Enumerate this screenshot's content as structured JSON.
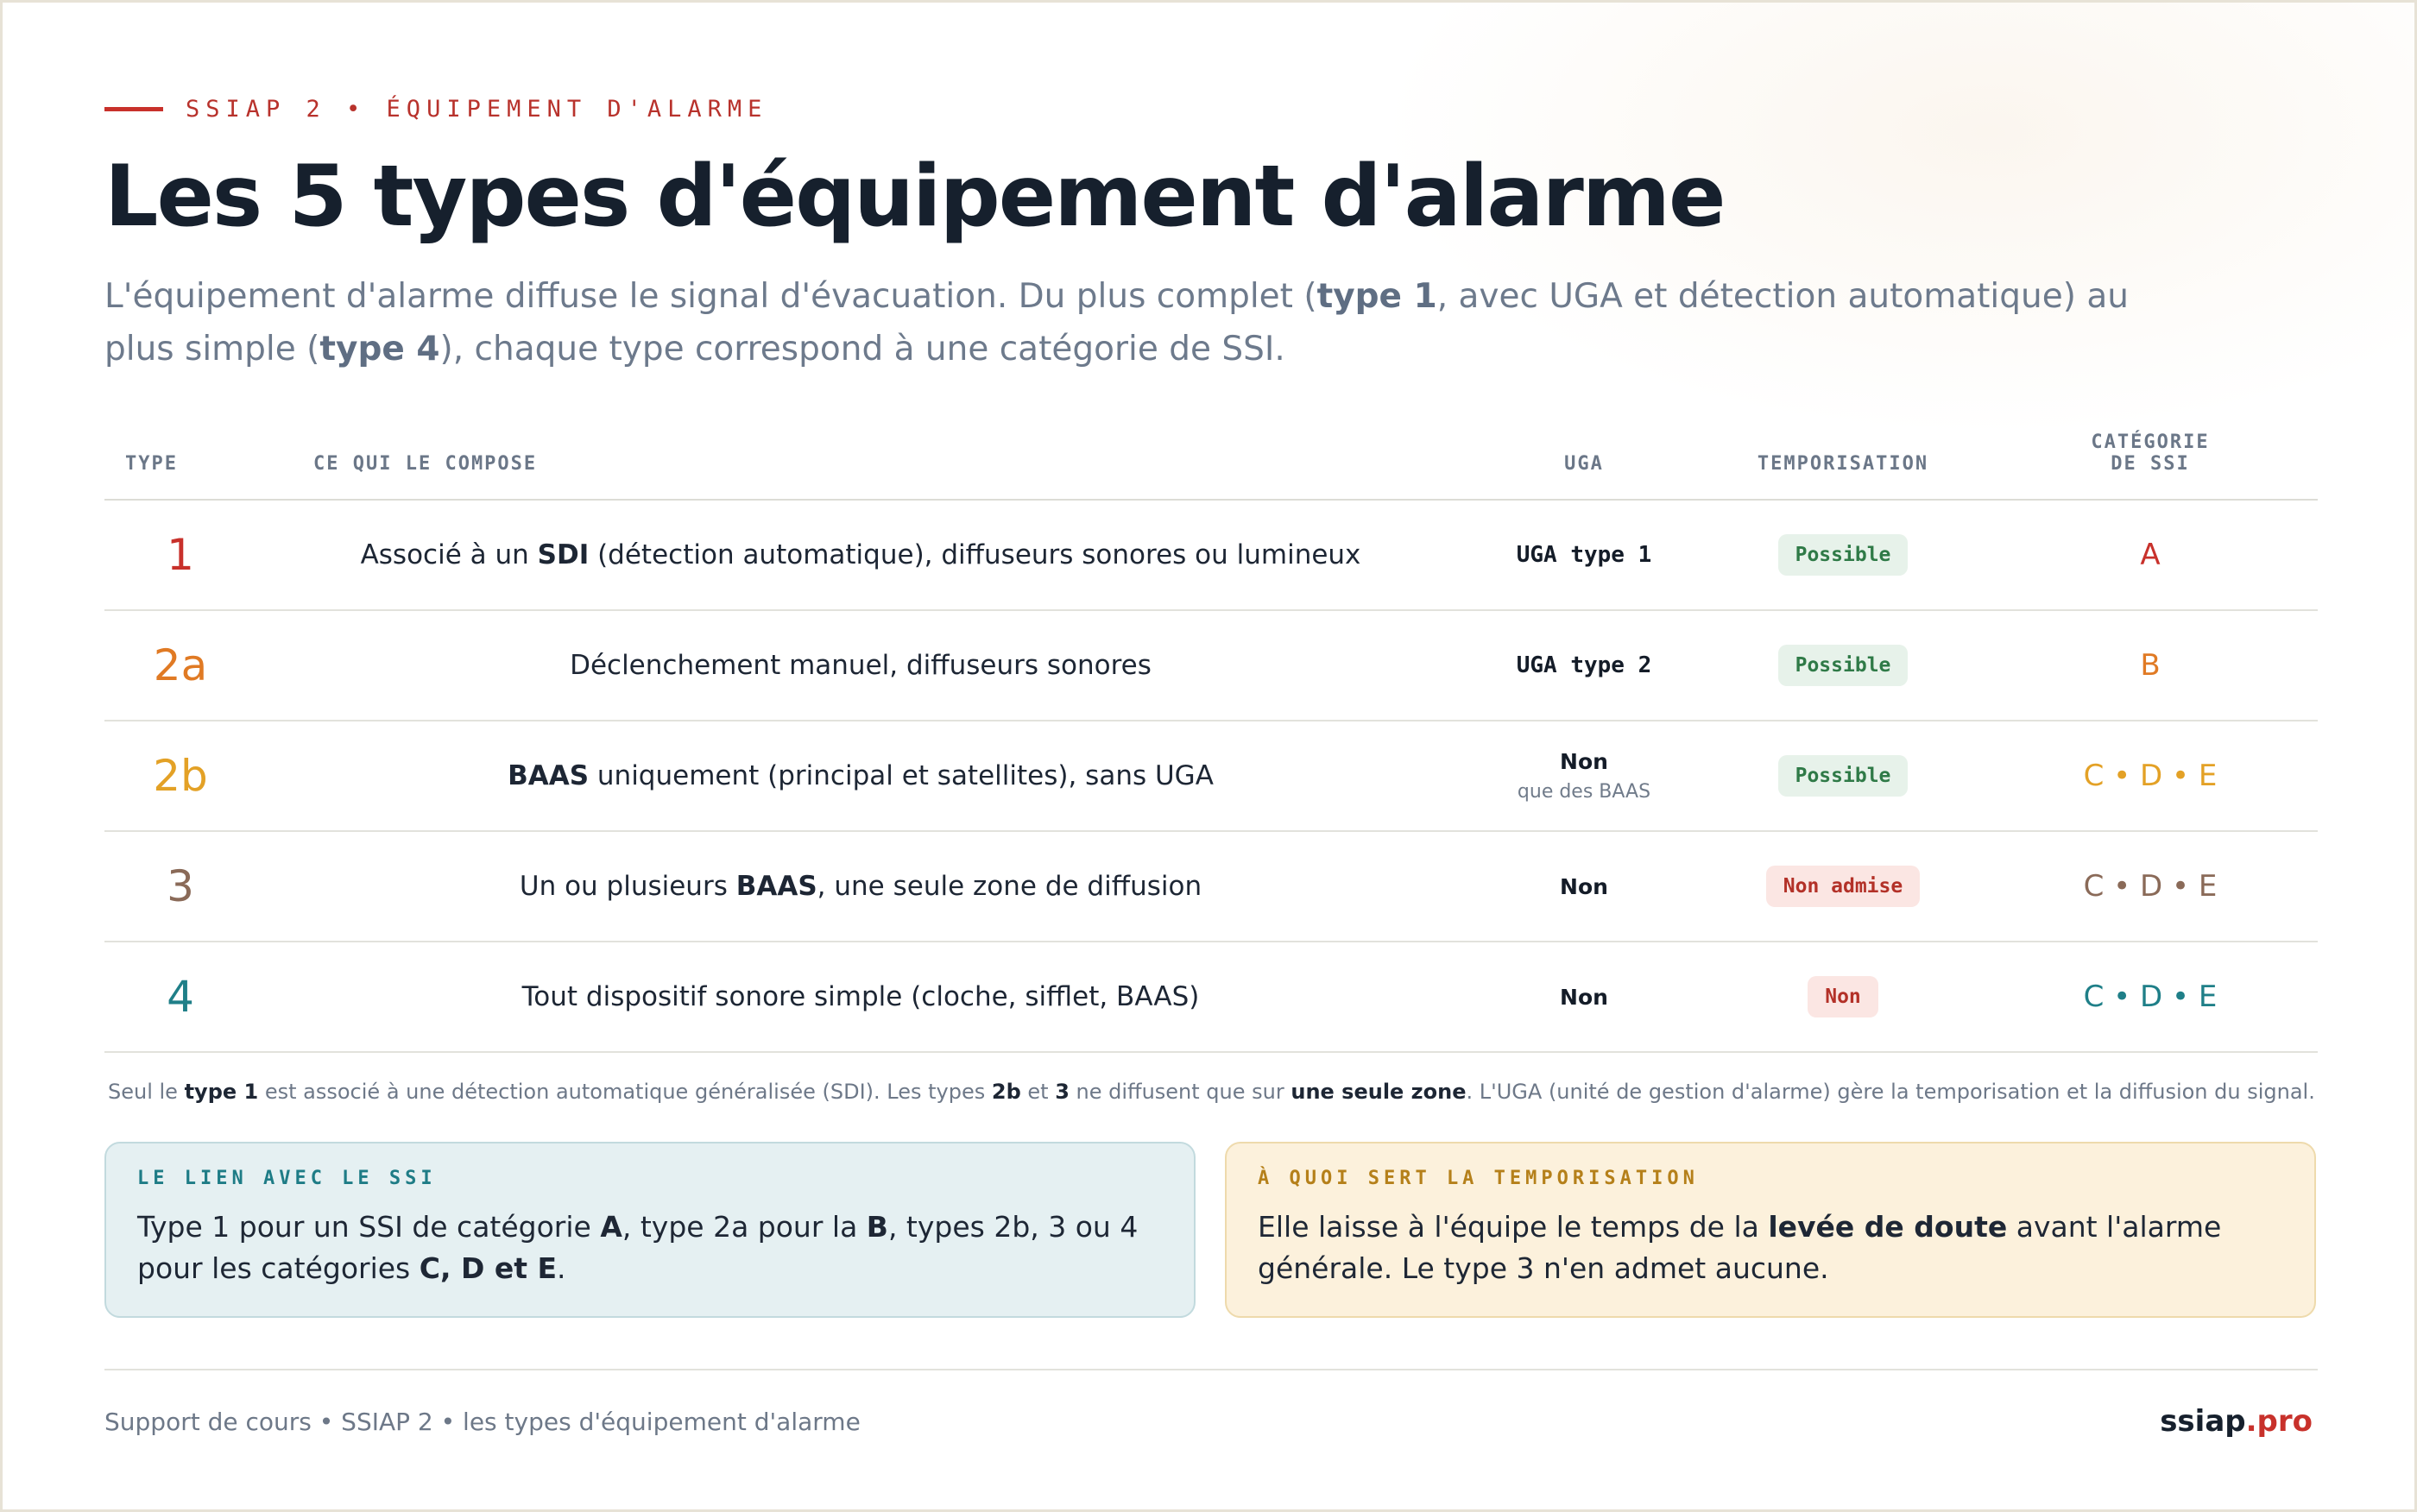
{
  "header": {
    "eyebrow": "SSIAP 2 • ÉQUIPEMENT D'ALARME",
    "title": "Les 5 types d'équipement d'alarme",
    "subtitle": {
      "p1": "L'équipement d'alarme diffuse le signal d'évacuation. Du plus complet (",
      "b1": "type 1",
      "p2": ", avec UGA et détection automatique) au plus simple (",
      "b2": "type 4",
      "p3": "), chaque type correspond à une catégorie de SSI."
    }
  },
  "table": {
    "headers": {
      "type": "TYPE",
      "composition": "CE QUI LE COMPOSE",
      "uga": "UGA",
      "temporisation": "TEMPORISATION",
      "categorie_l1": "CATÉGORIE",
      "categorie_l2": "DE SSI"
    },
    "rows": [
      {
        "type": "1",
        "color": "#c8312b",
        "comp_a": "Associé à un ",
        "comp_b": "SDI",
        "comp_c": " (détection automatique), diffuseurs sonores ou lumineux",
        "uga": "UGA type 1",
        "uga_sub": "",
        "temp": "Possible",
        "temp_status": "ok",
        "categorie": "A"
      },
      {
        "type": "2a",
        "color": "#e07a24",
        "comp_a": "Déclenchement manuel, diffuseurs sonores",
        "comp_b": "",
        "comp_c": "",
        "uga": "UGA type 2",
        "uga_sub": "",
        "temp": "Possible",
        "temp_status": "ok",
        "categorie": "B"
      },
      {
        "type": "2b",
        "color": "#e3a126",
        "comp_a": "",
        "comp_b": "BAAS",
        "comp_c": " uniquement (principal et satellites), sans UGA",
        "uga": "Non",
        "uga_sub": "que des BAAS",
        "temp": "Possible",
        "temp_status": "ok",
        "categorie": "C • D • E"
      },
      {
        "type": "3",
        "color": "#8a6a58",
        "comp_a": "Un ou plusieurs ",
        "comp_b": "BAAS",
        "comp_c": ", une seule zone de diffusion",
        "uga": "Non",
        "uga_sub": "",
        "temp": "Non admise",
        "temp_status": "no",
        "categorie": "C • D • E"
      },
      {
        "type": "4",
        "color": "#1f7f88",
        "comp_a": "Tout dispositif sonore simple (cloche, sifflet, BAAS)",
        "comp_b": "",
        "comp_c": "",
        "uga": "Non",
        "uga_sub": "",
        "temp": "Non",
        "temp_status": "no",
        "categorie": "C • D • E"
      }
    ]
  },
  "note": {
    "t1": "Seul le ",
    "b1": "type 1",
    "t2": " est associé à une détection automatique généralisée (SDI). Les types ",
    "b2": "2b",
    "t3": " et ",
    "b3": "3",
    "t4": " ne diffusent que sur ",
    "b4": "une seule zone",
    "t5": ". L'UGA (unité de gestion d'alarme) gère la temporisation et la diffusion du signal."
  },
  "cards": {
    "ssi": {
      "heading": "LE LIEN AVEC LE SSI",
      "t1": "Type 1 pour un SSI de catégorie ",
      "b1": "A",
      "t2": ", type 2a pour la ",
      "b2": "B",
      "t3": ", types 2b, 3 ou 4 pour les catégories ",
      "b3": "C, D et E",
      "t4": "."
    },
    "tempo": {
      "heading": "À QUOI SERT LA TEMPORISATION",
      "t1": "Elle laisse à l'équipe le temps de la ",
      "b1": "levée de doute",
      "t2": " avant l'alarme générale. Le type 3 n'en admet aucune."
    }
  },
  "footer": {
    "left": "Support de cours • SSIAP 2 • les types d'équipement d'alarme",
    "brand": "ssiap",
    "tld": ".pro"
  },
  "colors": {
    "accent": "#c8312b",
    "type1": "#c8312b",
    "type2a": "#e07a24",
    "type2b": "#e3a126",
    "type3": "#8a6a58",
    "type4": "#1f7f88",
    "ok_bg": "#e7f2ea",
    "ok_text": "#2f7a47",
    "no_bg": "#fbe6e3",
    "no_text": "#b33128"
  }
}
